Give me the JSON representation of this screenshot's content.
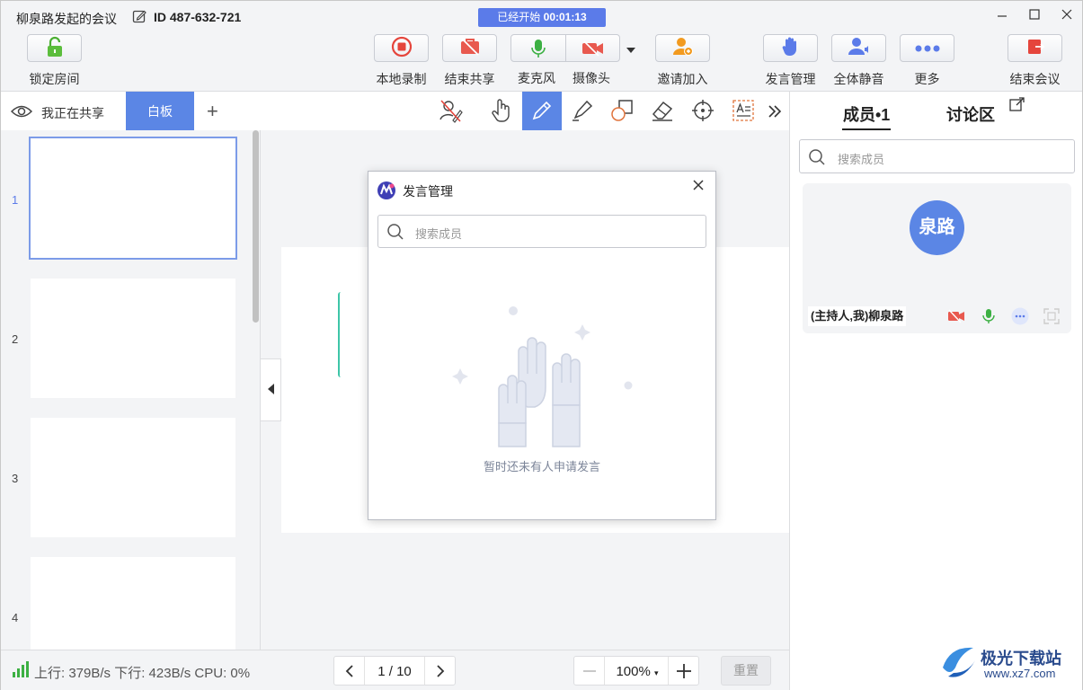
{
  "titlebar": {
    "title": "柳泉路发起的会议",
    "meeting_id": "ID 487-632-721",
    "timer_prefix": "已经开始",
    "timer_value": "00:01:13"
  },
  "toolbar": {
    "lock": "锁定房间",
    "record": "本地录制",
    "end_share": "结束共享",
    "mic": "麦克风",
    "camera": "摄像头",
    "invite": "邀请加入",
    "speech_mgmt": "发言管理",
    "mute_all": "全体静音",
    "more": "更多",
    "end_meeting": "结束会议"
  },
  "sharebar": {
    "sharing_label": "我正在共享",
    "whiteboard_tab": "白板",
    "add": "+"
  },
  "thumbnails": [
    "1",
    "2",
    "3",
    "4"
  ],
  "whiteboard": {
    "ghost_label": ""
  },
  "dialog": {
    "title": "发言管理",
    "search_placeholder": "搜索成员",
    "empty_text": "暂时还未有人申请发言"
  },
  "bottombar": {
    "stats": "上行: 379B/s  下行: 423B/s  CPU:  0%",
    "page": "1 / 10",
    "zoom": "100%",
    "reset": "重置"
  },
  "right_panel": {
    "tab_members": "成员•1",
    "tab_discussion": "讨论区",
    "search_placeholder": "搜索成员",
    "member": {
      "avatar_text": "泉路",
      "name": "(主持人,我)柳泉路"
    }
  },
  "watermark": {
    "line1": "极光下载站",
    "line2": "www.xz7.com"
  },
  "colors": {
    "accent": "#5b86e5",
    "timer_bg": "#5b7be9",
    "danger": "#e5453c",
    "mic_green": "#3cb043"
  }
}
